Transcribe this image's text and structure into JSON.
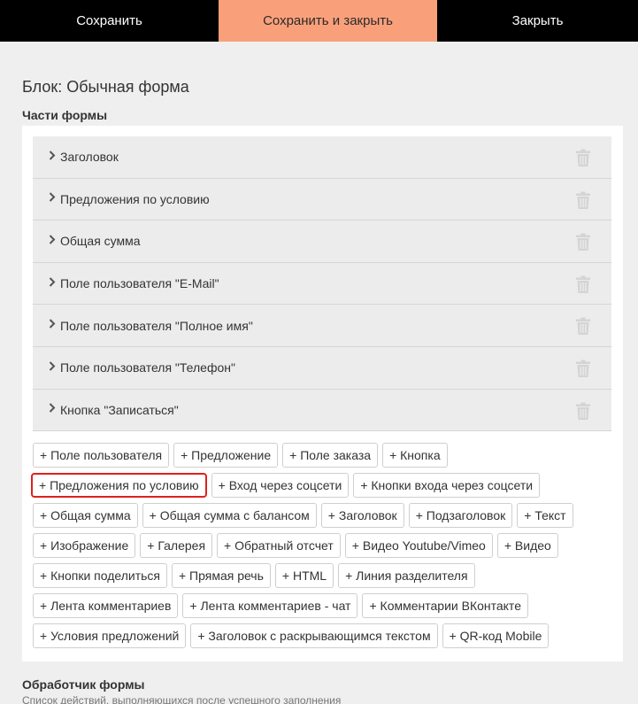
{
  "toolbar": {
    "save_label": "Сохранить",
    "save_close_label": "Сохранить и закрыть",
    "close_label": "Закрыть",
    "save_close_color": "#f9a07b"
  },
  "page": {
    "block_title": "Блок: Обычная форма",
    "parts_title": "Части формы"
  },
  "parts": [
    {
      "label": "Заголовок"
    },
    {
      "label": "Предложения по условию"
    },
    {
      "label": "Общая сумма"
    },
    {
      "label": "Поле пользователя \"E-Mail\""
    },
    {
      "label": "Поле пользователя \"Полное имя\""
    },
    {
      "label": "Поле пользователя \"Телефон\""
    },
    {
      "label": "Кнопка \"Записаться\""
    }
  ],
  "add_buttons": [
    [
      "+ Поле пользователя",
      "+ Предложение",
      "+ Поле заказа",
      "+ Кнопка"
    ],
    [
      "+ Предложения по условию",
      "+ Вход через соцсети",
      "+ Кнопки входа через соцсети"
    ],
    [
      "+ Общая сумма",
      "+ Общая сумма с балансом",
      "+ Заголовок",
      "+ Подзаголовок",
      "+ Текст"
    ],
    [
      "+ Изображение",
      "+ Галерея",
      "+ Обратный отсчет",
      "+ Видео Youtube/Vimeo",
      "+ Видео"
    ],
    [
      "+ Кнопки поделиться",
      "+ Прямая речь",
      "+ HTML",
      "+ Линия разделителя"
    ],
    [
      "+ Лента комментариев",
      "+ Лента комментариев - чат",
      "+ Комментарии ВКонтакте"
    ],
    [
      "+ Условия предложений",
      "+ Заголовок с раскрывающимся текстом",
      "+ QR-код Mobile"
    ]
  ],
  "handler": {
    "title": "Обработчик формы",
    "description": "Список действий, выполняющихся после успешного заполнения"
  },
  "icons": {
    "chevron": "chevron-right-icon",
    "trash": "trash-icon"
  },
  "highlight_color": "#e0201d"
}
